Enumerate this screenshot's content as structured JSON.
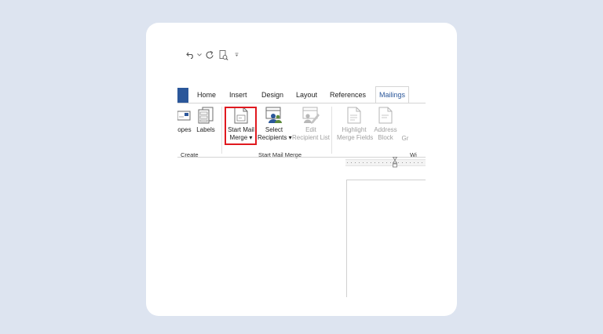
{
  "quick_access": {
    "undo_icon": "undo-icon",
    "undo_dropdown_icon": "chevron-down-icon",
    "redo_icon": "redo-icon",
    "print_preview_icon": "print-preview-icon",
    "customize_icon": "customize-qat-icon"
  },
  "tabs": [
    {
      "label": "Home"
    },
    {
      "label": "Insert"
    },
    {
      "label": "Design"
    },
    {
      "label": "Layout"
    },
    {
      "label": "References"
    },
    {
      "label": "Mailings",
      "active": true
    }
  ],
  "ribbon": {
    "create_group": {
      "envelopes_label": "lopes",
      "labels_label": "Labels",
      "group_label": "Create"
    },
    "start_mail_merge_group": {
      "start_mail_merge_line1": "Start Mail",
      "start_mail_merge_line2": "Merge ▾",
      "select_recipients_line1": "Select",
      "select_recipients_line2": "Recipients ▾",
      "edit_recipient_list_line1": "Edit",
      "edit_recipient_list_line2": "Recipient List",
      "group_label": "Start Mail Merge"
    },
    "write_insert_group": {
      "highlight_line1": "Highlight",
      "highlight_line2": "Merge Fields",
      "address_line1": "Address",
      "address_line2": "Block",
      "greeting_partial": "Gr",
      "group_label_partial": "Wi"
    }
  },
  "colors": {
    "accent": "#2b579a",
    "highlight_box": "#e0191f",
    "background": "#dde4f0"
  }
}
